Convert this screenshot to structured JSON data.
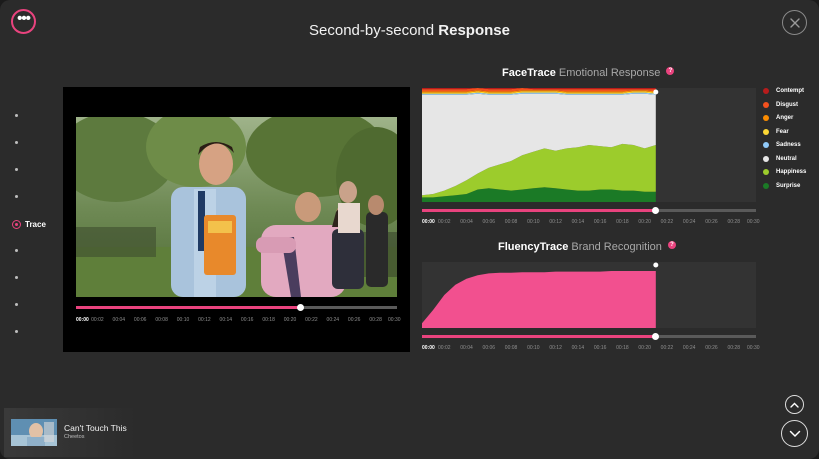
{
  "header": {
    "title_light": "Second-by-second",
    "title_bold": "Response"
  },
  "toolbar": {
    "menu_icon": "more-dots-icon",
    "close_icon": "close-icon"
  },
  "sidenav": {
    "active_label": "Trace"
  },
  "timeline": {
    "labels": [
      "00:00",
      "00:02",
      "00:04",
      "00:06",
      "00:08",
      "00:10",
      "00:12",
      "00:14",
      "00:16",
      "00:18",
      "00:20",
      "00:22",
      "00:24",
      "00:26",
      "00:28",
      "00:30"
    ],
    "current_seconds": 21,
    "total_seconds": 30
  },
  "facetrace": {
    "title_bold": "FaceTrace",
    "title_light": "Emotional Response",
    "help_label": "?"
  },
  "fluencytrace": {
    "title_bold": "FluencyTrace",
    "title_light": "Brand Recognition",
    "help_label": "?"
  },
  "legend": [
    {
      "label": "Contempt",
      "color": "#b71c1c"
    },
    {
      "label": "Disgust",
      "color": "#f4511e"
    },
    {
      "label": "Anger",
      "color": "#fb8c00"
    },
    {
      "label": "Fear",
      "color": "#fdd835"
    },
    {
      "label": "Sadness",
      "color": "#90caf9"
    },
    {
      "label": "Neutral",
      "color": "#e6e6e6"
    },
    {
      "label": "Happiness",
      "color": "#9ccc2c"
    },
    {
      "label": "Surprise",
      "color": "#1b7a26"
    }
  ],
  "chart_data": [
    {
      "type": "area",
      "title": "FaceTrace Emotional Response",
      "x": [
        0,
        1,
        2,
        3,
        4,
        5,
        6,
        7,
        8,
        9,
        10,
        11,
        12,
        13,
        14,
        15,
        16,
        17,
        18,
        19,
        20,
        21
      ],
      "stacked": true,
      "ylim": [
        0,
        100
      ],
      "xlim": [
        0,
        30
      ],
      "series": [
        {
          "name": "Surprise",
          "values": [
            4,
            4,
            5,
            6,
            7,
            11,
            12,
            11,
            10,
            11,
            12,
            13,
            12,
            11,
            10,
            10,
            11,
            11,
            10,
            10,
            9,
            9
          ]
        },
        {
          "name": "Happiness",
          "values": [
            2,
            3,
            5,
            8,
            12,
            14,
            18,
            22,
            26,
            30,
            32,
            34,
            33,
            36,
            38,
            40,
            38,
            37,
            41,
            40,
            38,
            41
          ]
        },
        {
          "name": "Neutral",
          "values": [
            88,
            87,
            84,
            80,
            75,
            70,
            64,
            61,
            58,
            54,
            51,
            48,
            50,
            47,
            46,
            44,
            45,
            46,
            43,
            45,
            48,
            44
          ]
        },
        {
          "name": "Sadness",
          "values": [
            1,
            1,
            1,
            1,
            1,
            1,
            1,
            1,
            1,
            1,
            1,
            1,
            1,
            1,
            1,
            1,
            1,
            1,
            1,
            1,
            1,
            1
          ]
        },
        {
          "name": "Fear",
          "values": [
            1,
            1,
            1,
            1,
            1,
            1,
            1,
            1,
            1,
            1,
            1,
            1,
            1,
            1,
            1,
            1,
            1,
            1,
            1,
            1,
            1,
            1
          ]
        },
        {
          "name": "Anger",
          "values": [
            1,
            1,
            1,
            1,
            1,
            1,
            1,
            1,
            1,
            1,
            1,
            1,
            1,
            1,
            1,
            1,
            1,
            1,
            1,
            1,
            1,
            1
          ]
        },
        {
          "name": "Disgust",
          "values": [
            2,
            2,
            2,
            2,
            2,
            2,
            2,
            2,
            2,
            2,
            1,
            1,
            1,
            2,
            2,
            2,
            2,
            2,
            2,
            1,
            1,
            2
          ]
        },
        {
          "name": "Contempt",
          "values": [
            1,
            1,
            1,
            1,
            1,
            1,
            1,
            1,
            1,
            1,
            1,
            1,
            1,
            1,
            1,
            1,
            1,
            1,
            1,
            1,
            1,
            1
          ]
        }
      ]
    },
    {
      "type": "area",
      "title": "FluencyTrace Brand Recognition",
      "x": [
        0,
        1,
        2,
        3,
        4,
        5,
        6,
        7,
        8,
        9,
        10,
        11,
        12,
        13,
        14,
        15,
        16,
        17,
        18,
        19,
        20,
        21
      ],
      "ylim": [
        0,
        100
      ],
      "xlim": [
        0,
        30
      ],
      "series": [
        {
          "name": "Brand Recognition",
          "values": [
            8,
            30,
            55,
            72,
            82,
            88,
            91,
            92,
            92,
            93,
            93,
            93,
            94,
            94,
            94,
            94,
            94,
            95,
            95,
            95,
            95,
            95
          ]
        }
      ]
    }
  ],
  "ad": {
    "title": "Can't Touch This",
    "brand": "Cheetos"
  },
  "navigation": {
    "up_icon": "chevron-up-icon",
    "down_icon": "chevron-down-icon"
  }
}
